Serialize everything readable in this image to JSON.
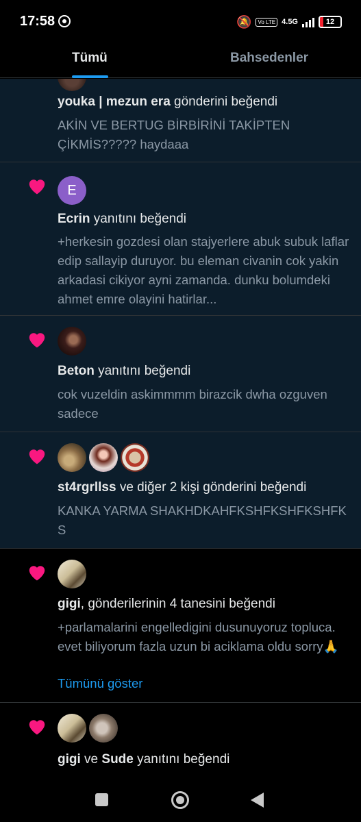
{
  "status_bar": {
    "time": "17:58",
    "volte": "Vo LTE",
    "network": "4.5G",
    "battery": "12"
  },
  "tabs": [
    {
      "label": "Tümü",
      "active": true
    },
    {
      "label": "Bahsedenler",
      "active": false
    }
  ],
  "notifications": [
    {
      "names": [
        "youka | mezun era"
      ],
      "action": " gönderini beğendi",
      "text": "AKİN VE BERTUG BİRBİRİNİ TAKİPTEN ÇİKMİS????? haydaaa"
    },
    {
      "avatar_letter": "E",
      "names": [
        "Ecrin"
      ],
      "action": " yanıtını beğendi",
      "text": "+herkesin gozdesi olan stajyerlere abuk subuk laflar edip sallayip duruyor. bu eleman civanin cok yakin arkadasi cikiyor ayni zamanda. dunku bolumdeki ahmet emre olayini hatirlar..."
    },
    {
      "names": [
        "Beton"
      ],
      "action": " yanıtını beğendi",
      "text": "cok vuzeldin askimmmm birazcik dwha ozguven sadece"
    },
    {
      "names": [
        "st4rgrllss"
      ],
      "action": " ve diğer 2 kişi gönderini beğendi",
      "text": "KANKA YARMA SHAKHDKAHFKSHFKSHFKSHFKS"
    },
    {
      "names": [
        "gigi"
      ],
      "action": ", gönderilerinin 4 tanesini beğendi",
      "text": "+parlamalarini engelledigini dusunuyoruz topluca. evet biliyorum fazla uzun bi aciklama oldu sorry🙏",
      "show_more": "Tümünü göster"
    },
    {
      "names": [
        "gigi",
        "Sude"
      ],
      "joiner": " ve ",
      "action": " yanıtını beğendi"
    }
  ],
  "colors": {
    "unread_bg": "#0c1d2b",
    "heart": "#f91880",
    "link": "#1d9bf0",
    "muted_text": "#8b98a5"
  }
}
